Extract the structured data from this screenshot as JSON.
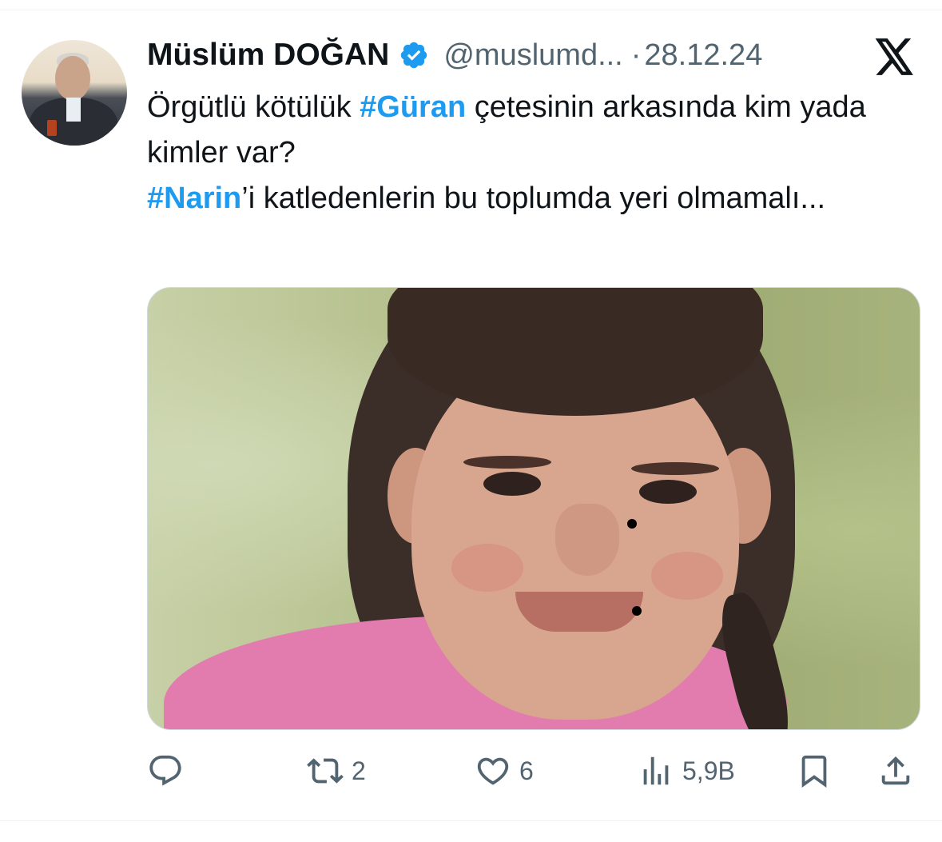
{
  "tweet": {
    "author_name": "Müslüm DOĞAN",
    "handle": "@muslumd...",
    "separator": "·",
    "date": "28.12.24",
    "text": [
      {
        "type": "text",
        "value": "Örgütlü kötülük "
      },
      {
        "type": "hashtag",
        "value": "#Güran"
      },
      {
        "type": "text",
        "value": " çetesinin arkasında kim yada kimler var?"
      },
      {
        "type": "break"
      },
      {
        "type": "hashtag",
        "value": "#Narin"
      },
      {
        "type": "text",
        "value": "’i katledenlerin bu toplumda yeri olmamalı..."
      }
    ]
  },
  "actions": {
    "reply_count": "",
    "retweet_count": "2",
    "like_count": "6",
    "views_count": "5,9B"
  },
  "colors": {
    "link": "#1d9bf0",
    "muted": "#536471",
    "verified": "#1d9bf0"
  },
  "icons": {
    "verified": "verified-badge-icon",
    "brand": "x-logo-icon",
    "reply": "reply-icon",
    "retweet": "retweet-icon",
    "like": "heart-icon",
    "views": "views-icon",
    "bookmark": "bookmark-icon",
    "share": "share-icon"
  }
}
